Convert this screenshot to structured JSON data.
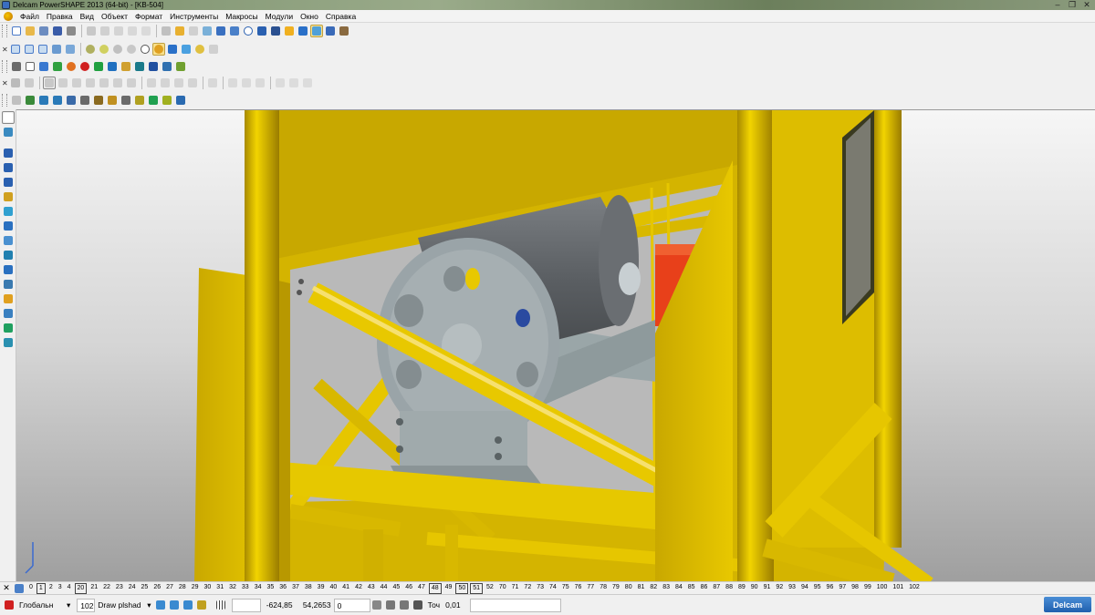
{
  "window": {
    "title": "Delcam PowerSHAPE 2013 (64-bit) - [KB-504]"
  },
  "menu": [
    "Файл",
    "Правка",
    "Вид",
    "Объект",
    "Формат",
    "Инструменты",
    "Макросы",
    "Модули",
    "Окно",
    "Справка"
  ],
  "levels": [
    {
      "label": "0",
      "boxed": false
    },
    {
      "label": "1",
      "boxed": true
    },
    {
      "label": "2",
      "boxed": false
    },
    {
      "label": "3",
      "boxed": false
    },
    {
      "label": "4",
      "boxed": false
    },
    {
      "label": "20",
      "boxed": true
    },
    {
      "label": "21",
      "boxed": false
    },
    {
      "label": "22",
      "boxed": false
    },
    {
      "label": "23",
      "boxed": false
    },
    {
      "label": "24",
      "boxed": false
    },
    {
      "label": "25",
      "boxed": false
    },
    {
      "label": "26",
      "boxed": false
    },
    {
      "label": "27",
      "boxed": false
    },
    {
      "label": "28",
      "boxed": false
    },
    {
      "label": "29",
      "boxed": false
    },
    {
      "label": "30",
      "boxed": false
    },
    {
      "label": "31",
      "boxed": false
    },
    {
      "label": "32",
      "boxed": false
    },
    {
      "label": "33",
      "boxed": false
    },
    {
      "label": "34",
      "boxed": false
    },
    {
      "label": "35",
      "boxed": false
    },
    {
      "label": "36",
      "boxed": false
    },
    {
      "label": "37",
      "boxed": false
    },
    {
      "label": "38",
      "boxed": false
    },
    {
      "label": "39",
      "boxed": false
    },
    {
      "label": "40",
      "boxed": false
    },
    {
      "label": "41",
      "boxed": false
    },
    {
      "label": "42",
      "boxed": false
    },
    {
      "label": "43",
      "boxed": false
    },
    {
      "label": "44",
      "boxed": false
    },
    {
      "label": "45",
      "boxed": false
    },
    {
      "label": "46",
      "boxed": false
    },
    {
      "label": "47",
      "boxed": false
    },
    {
      "label": "48",
      "boxed": true
    },
    {
      "label": "49",
      "boxed": false
    },
    {
      "label": "50",
      "boxed": true
    },
    {
      "label": "51",
      "boxed": true
    },
    {
      "label": "52",
      "boxed": false
    },
    {
      "label": "70",
      "boxed": false
    },
    {
      "label": "71",
      "boxed": false
    },
    {
      "label": "72",
      "boxed": false
    },
    {
      "label": "73",
      "boxed": false
    },
    {
      "label": "74",
      "boxed": false
    },
    {
      "label": "75",
      "boxed": false
    },
    {
      "label": "76",
      "boxed": false
    },
    {
      "label": "77",
      "boxed": false
    },
    {
      "label": "78",
      "boxed": false
    },
    {
      "label": "79",
      "boxed": false
    },
    {
      "label": "80",
      "boxed": false
    },
    {
      "label": "81",
      "boxed": false
    },
    {
      "label": "82",
      "boxed": false
    },
    {
      "label": "83",
      "boxed": false
    },
    {
      "label": "84",
      "boxed": false
    },
    {
      "label": "85",
      "boxed": false
    },
    {
      "label": "86",
      "boxed": false
    },
    {
      "label": "87",
      "boxed": false
    },
    {
      "label": "88",
      "boxed": false
    },
    {
      "label": "89",
      "boxed": false
    },
    {
      "label": "90",
      "boxed": false
    },
    {
      "label": "91",
      "boxed": false
    },
    {
      "label": "92",
      "boxed": false
    },
    {
      "label": "93",
      "boxed": false
    },
    {
      "label": "94",
      "boxed": false
    },
    {
      "label": "95",
      "boxed": false
    },
    {
      "label": "96",
      "boxed": false
    },
    {
      "label": "97",
      "boxed": false
    },
    {
      "label": "98",
      "boxed": false
    },
    {
      "label": "99",
      "boxed": false
    },
    {
      "label": "100",
      "boxed": false
    },
    {
      "label": "101",
      "boxed": false
    },
    {
      "label": "102",
      "boxed": false
    }
  ],
  "status": {
    "workplane": "Глобальн",
    "level_number": "102",
    "level_name": "Draw plshad",
    "coord_x": "-624,85",
    "coord_y": "54,2653",
    "coord_z": "0",
    "tolerance_label": "Точ",
    "tolerance_value": "0,01"
  },
  "brand": {
    "logo": "Delcam"
  },
  "colors": {
    "frame": "#e8c400",
    "drum": "#5f6368",
    "drum_end": "#9aa4a8",
    "motor": "#e8401a",
    "viewport_top": "#f4f4f4",
    "viewport_bottom": "#a9a9a9"
  }
}
